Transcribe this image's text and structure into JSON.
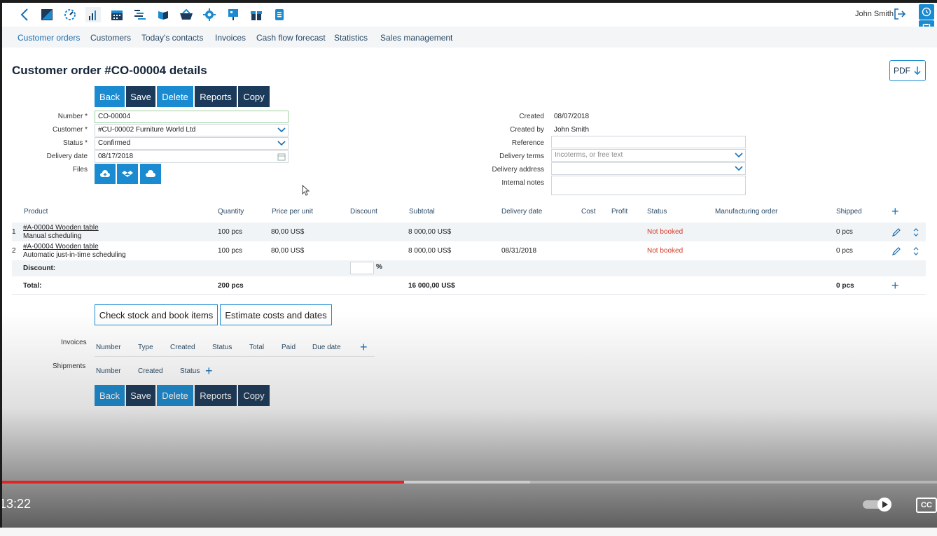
{
  "toolbar": {
    "icons": [
      "back-chevron-icon",
      "edit-square-icon",
      "dashboard-gauge-icon",
      "bar-chart-icon",
      "calendar-icon",
      "gantt-icon",
      "book-icon",
      "basket-icon",
      "settings-icon",
      "presentation-icon",
      "gift-icon",
      "document-icon"
    ],
    "user_name": "John Smith"
  },
  "nav": {
    "items": [
      "Customer orders",
      "Customers",
      "Today's contacts",
      "Invoices",
      "Cash flow forecast",
      "Statistics",
      "Sales management"
    ]
  },
  "page": {
    "title": "Customer order #CO-00004 details",
    "pdf_label": "PDF"
  },
  "actions": {
    "back": "Back",
    "save": "Save",
    "delete": "Delete",
    "reports": "Reports",
    "copy": "Copy"
  },
  "form_left": {
    "number_label": "Number *",
    "number_value": "CO-00004",
    "customer_label": "Customer *",
    "customer_value": "#CU-00002 Furniture World Ltd",
    "status_label": "Status *",
    "status_value": "Confirmed",
    "delivery_date_label": "Delivery date",
    "delivery_date_value": "08/17/2018",
    "files_label": "Files"
  },
  "form_right": {
    "created_label": "Created",
    "created_value": "08/07/2018",
    "created_by_label": "Created by",
    "created_by_value": "John Smith",
    "reference_label": "Reference",
    "reference_value": "",
    "delivery_terms_label": "Delivery terms",
    "delivery_terms_placeholder": "Incoterms, or free text",
    "delivery_address_label": "Delivery address",
    "delivery_address_value": "",
    "internal_notes_label": "Internal notes",
    "internal_notes_value": ""
  },
  "table": {
    "headers": [
      "Product",
      "Quantity",
      "Price per unit",
      "Discount",
      "Subtotal",
      "Delivery date",
      "Cost",
      "Profit",
      "Status",
      "Manufacturing order",
      "Shipped"
    ],
    "rows": [
      {
        "index": "1",
        "product": "#A-00004 Wooden table",
        "scheduling": "Manual scheduling",
        "quantity": "100 pcs",
        "price": "80,00 US$",
        "discount": "",
        "subtotal": "8 000,00 US$",
        "delivery_date": "",
        "status": "Not booked",
        "shipped": "0 pcs"
      },
      {
        "index": "2",
        "product": "#A-00004 Wooden table",
        "scheduling": "Automatic just-in-time scheduling",
        "quantity": "100 pcs",
        "price": "80,00 US$",
        "discount": "",
        "subtotal": "8 000,00 US$",
        "delivery_date": "08/31/2018",
        "status": "Not booked",
        "shipped": "0 pcs"
      }
    ],
    "discount_label": "Discount:",
    "discount_unit": "%",
    "total_label": "Total:",
    "total_quantity": "200 pcs",
    "total_subtotal": "16 000,00 US$",
    "total_shipped": "0 pcs"
  },
  "stock_actions": {
    "check_stock": "Check stock and book items",
    "estimate": "Estimate costs and dates"
  },
  "invoices": {
    "label": "Invoices",
    "headers": [
      "Number",
      "Type",
      "Created",
      "Status",
      "Total",
      "Paid",
      "Due date"
    ]
  },
  "shipments": {
    "label": "Shipments",
    "headers": [
      "Number",
      "Created",
      "Status"
    ]
  },
  "video": {
    "time": "13:22",
    "progress": 0.43,
    "buffered": 0.565,
    "cc_label": "CC"
  },
  "colors": {
    "accent": "#1a8bd0",
    "dark_button": "#1c3a5a",
    "status_red": "#d13b2b",
    "progress_red": "#e32222"
  }
}
